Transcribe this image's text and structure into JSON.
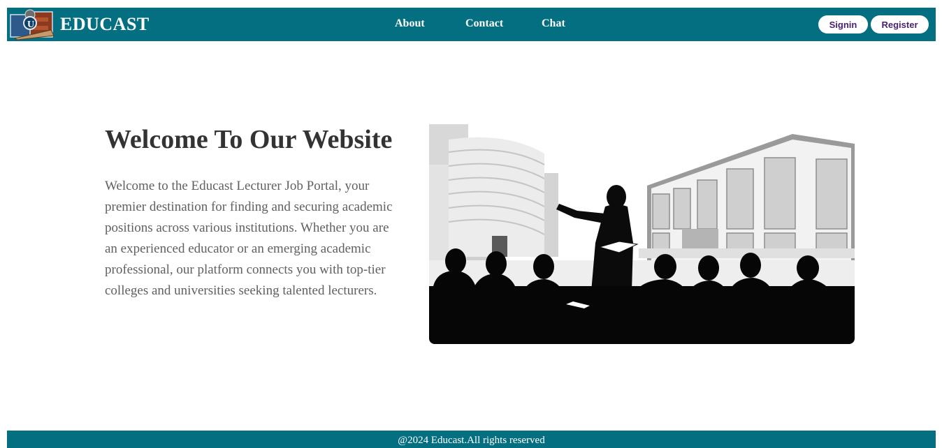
{
  "header": {
    "brand": "EDUCAST",
    "nav": [
      {
        "label": "About"
      },
      {
        "label": "Contact"
      },
      {
        "label": "Chat"
      }
    ],
    "signin_label": "Signin",
    "register_label": "Register"
  },
  "hero": {
    "title": "Welcome To Our Website",
    "description": "Welcome to the Educast Lecturer Job Portal, your premier destination for finding and securing academic positions across various institutions. Whether you are an experienced educator or an emerging academic professional, our platform connects you with top-tier colleges and universities seeking talented lecturers."
  },
  "footer": {
    "text": "@2024 Educast.All rights reserved"
  },
  "colors": {
    "header_bg": "#046f80",
    "footer_bg": "#046f80",
    "button_text": "#4a2270",
    "title_text": "#333333",
    "body_text": "#606060"
  }
}
